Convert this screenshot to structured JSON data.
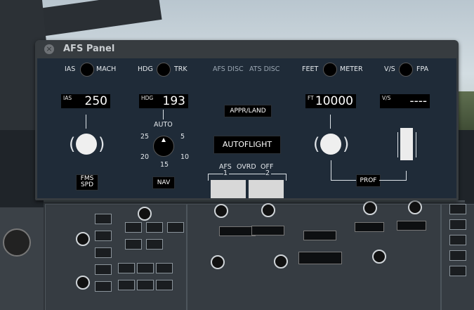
{
  "window": {
    "title": "AFS Panel",
    "close_label": "×"
  },
  "top_row": {
    "ias": "IAS",
    "mach": "MACH",
    "hdg": "HDG",
    "trk": "TRK",
    "afs_disc": "AFS DISC",
    "ats_disc": "ATS DISC",
    "feet": "FEET",
    "meter": "METER",
    "vs": "V/S",
    "fpa": "FPA"
  },
  "speed": {
    "label": "IAS",
    "value": "250",
    "fms_button": "FMS\nSPD"
  },
  "heading": {
    "label": "HDG",
    "value": "193",
    "auto": "AUTO",
    "bank_25": "25",
    "bank_5": "5",
    "bank_20": "20",
    "bank_10": "10",
    "bank_15": "15",
    "nav_button": "NAV"
  },
  "center": {
    "appr_land": "APPR/LAND",
    "autoflight": "AUTOFLIGHT",
    "afs_ovrd": "AFS",
    "ovrd": "OVRD",
    "off": "OFF",
    "one": "1",
    "two": "2"
  },
  "altitude": {
    "label": "FT",
    "value": "10000",
    "prof_button": "PROF"
  },
  "vertical_speed": {
    "label": "V/S",
    "value": "----"
  }
}
